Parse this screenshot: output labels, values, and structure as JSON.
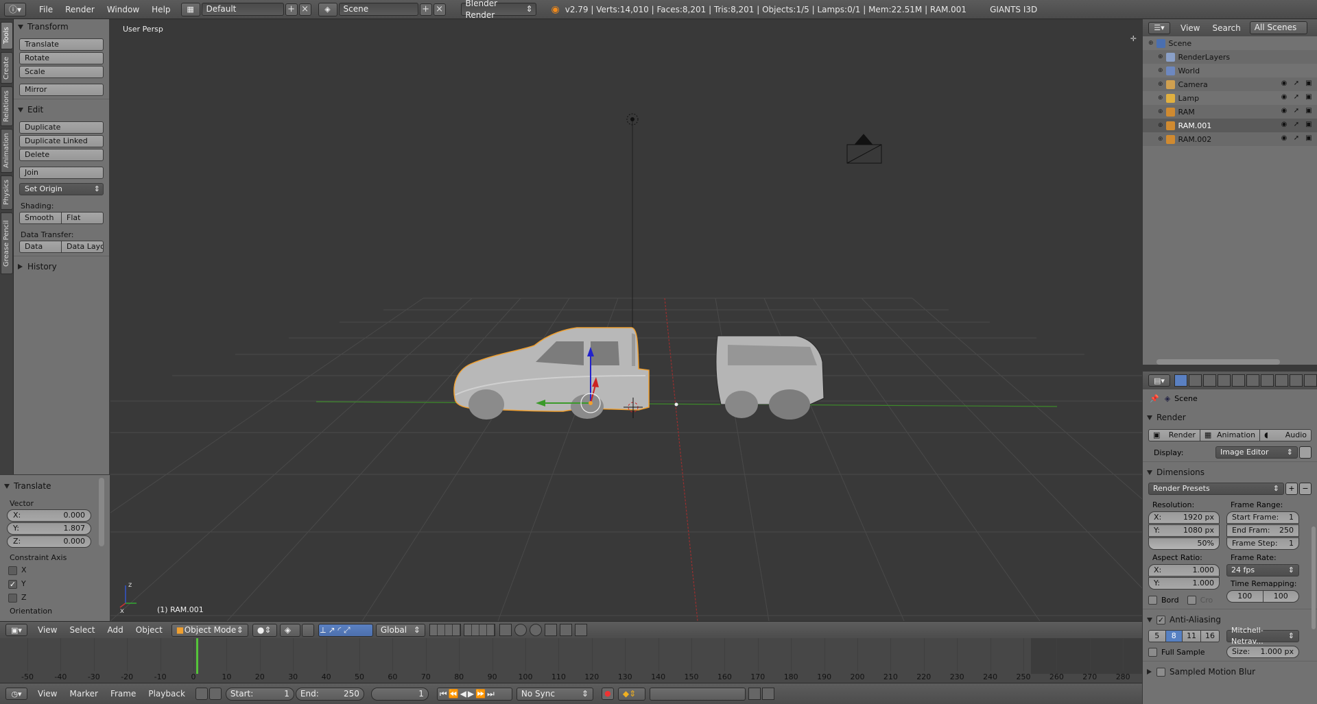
{
  "topbar": {
    "menus": [
      "File",
      "Render",
      "Window",
      "Help"
    ],
    "screen_layout": "Default",
    "scene": "Scene",
    "engine": "Blender Render",
    "stats": "v2.79 | Verts:14,010 | Faces:8,201 | Tris:8,201 | Objects:1/5 | Lamps:0/1 | Mem:22.51M | RAM.001",
    "plugin": "GIANTS I3D"
  },
  "tabs": [
    "Tools",
    "Create",
    "Relations",
    "Animation",
    "Physics",
    "Grease Pencil"
  ],
  "shelf": {
    "transform": {
      "title": "Transform",
      "buttons": [
        "Translate",
        "Rotate",
        "Scale",
        "Mirror"
      ]
    },
    "edit": {
      "title": "Edit",
      "buttons": [
        "Duplicate",
        "Duplicate Linked",
        "Delete",
        "Join"
      ],
      "set_origin": "Set Origin"
    },
    "shading": {
      "label": "Shading:",
      "smooth": "Smooth",
      "flat": "Flat"
    },
    "data_transfer": {
      "label": "Data Transfer:",
      "data": "Data",
      "data_layout": "Data Layo"
    },
    "history": "History"
  },
  "operator": {
    "title": "Translate",
    "vector_label": "Vector",
    "x_label": "X:",
    "x": "0.000",
    "y_label": "Y:",
    "y": "1.807",
    "z_label": "Z:",
    "z": "0.000",
    "constraint_label": "Constraint Axis",
    "axes": [
      "X",
      "Y",
      "Z"
    ],
    "axes_checked": [
      false,
      true,
      false
    ],
    "orientation": "Orientation"
  },
  "viewport": {
    "view_name": "User Persp",
    "object_label": "(1) RAM.001",
    "gizmo_x": "x",
    "gizmo_z": "z"
  },
  "view_header": {
    "menus": [
      "View",
      "Select",
      "Add",
      "Object"
    ],
    "mode": "Object Mode",
    "orientation": "Global"
  },
  "timeline": {
    "ticks": [
      -50,
      -40,
      -30,
      -20,
      -10,
      0,
      10,
      20,
      30,
      40,
      50,
      60,
      70,
      80,
      90,
      100,
      110,
      120,
      130,
      140,
      150,
      160,
      170,
      180,
      190,
      200,
      210,
      220,
      230,
      240,
      250,
      260,
      270,
      280
    ],
    "current_frame": 1
  },
  "timeline_header": {
    "menus": [
      "View",
      "Marker",
      "Frame",
      "Playback"
    ],
    "start_label": "Start:",
    "start": "1",
    "end_label": "End:",
    "end": "250",
    "frame": "1",
    "sync": "No Sync"
  },
  "outliner": {
    "menus": [
      "View",
      "Search"
    ],
    "filter": "All Scenes",
    "items": [
      {
        "name": "Scene",
        "depth": 0,
        "vis": false
      },
      {
        "name": "RenderLayers",
        "depth": 1,
        "vis": false
      },
      {
        "name": "World",
        "depth": 1,
        "vis": false
      },
      {
        "name": "Camera",
        "depth": 1,
        "vis": true
      },
      {
        "name": "Lamp",
        "depth": 1,
        "vis": true
      },
      {
        "name": "RAM",
        "depth": 1,
        "vis": true
      },
      {
        "name": "RAM.001",
        "depth": 1,
        "vis": true,
        "selected": true
      },
      {
        "name": "RAM.002",
        "depth": 1,
        "vis": true
      }
    ]
  },
  "properties": {
    "context": "Scene",
    "render": {
      "title": "Render",
      "buttons": [
        "Render",
        "Animation",
        "Audio"
      ],
      "display_label": "Display:",
      "display": "Image Editor"
    },
    "dimensions": {
      "title": "Dimensions",
      "presets": "Render Presets",
      "resolution_label": "Resolution:",
      "res_x_label": "X:",
      "res_x": "1920 px",
      "res_y_label": "Y:",
      "res_y": "1080 px",
      "res_pct": "50%",
      "frame_range_label": "Frame Range:",
      "start_label": "Start Frame:",
      "start": "1",
      "end_label": "End Fram:",
      "end": "250",
      "step_label": "Frame Step:",
      "step": "1",
      "aspect_label": "Aspect Ratio:",
      "asp_x_label": "X:",
      "asp_x": "1.000",
      "asp_y_label": "Y:",
      "asp_y": "1.000",
      "frame_rate_label": "Frame Rate:",
      "fps": "24 fps",
      "time_remap_label": "Time Remapping:",
      "remap_old": "100",
      "remap_new": "100",
      "bord": "Bord",
      "crop": "Cro"
    },
    "aa": {
      "title": "Anti-Aliasing",
      "samples": [
        "5",
        "8",
        "11",
        "16"
      ],
      "active_sample": "8",
      "filter": "Mitchell-Netrav...",
      "full_sample": "Full Sample",
      "size_label": "Size:",
      "size": "1.000 px"
    },
    "motion_blur": "Sampled Motion Blur"
  },
  "colors": {
    "selection_outline": "#f0a030",
    "x_axis": "#b33030",
    "y_axis": "#3a8f2a",
    "active_blue": "#5680c2",
    "playhead": "#55c43a"
  }
}
